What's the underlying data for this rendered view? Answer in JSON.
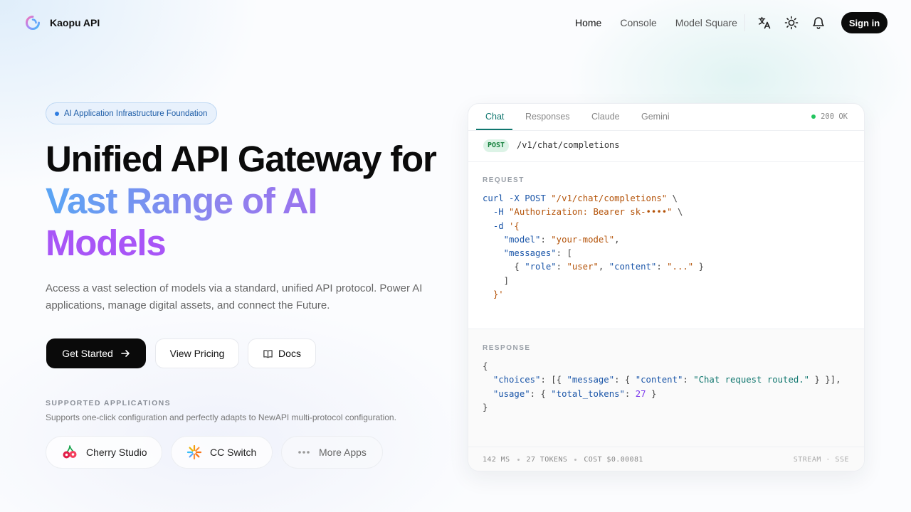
{
  "nav": {
    "brand": "Kaopu API",
    "links": [
      "Home",
      "Console",
      "Model Square"
    ],
    "icons": [
      "translate-icon",
      "sun-icon",
      "bell-icon"
    ],
    "signin": "Sign in"
  },
  "hero": {
    "badge": "AI Application Infrastructure Foundation",
    "title_line1": "Unified API Gateway for",
    "title_line2": "Vast Range of AI",
    "title_line3": "Models",
    "description": "Access a vast selection of models via a standard, unified API protocol. Power AI applications, manage digital assets, and connect the Future.",
    "buttons": {
      "get_started": "Get Started",
      "view_pricing": "View Pricing",
      "docs": "Docs"
    },
    "supported_title": "SUPPORTED APPLICATIONS",
    "supported_desc": "Supports one-click configuration and perfectly adapts to NewAPI multi-protocol configuration.",
    "apps": [
      "Cherry Studio",
      "CC Switch",
      "More Apps"
    ]
  },
  "card": {
    "tabs": [
      "Chat",
      "Responses",
      "Claude",
      "Gemini"
    ],
    "active_tab": "Chat",
    "status": "200 OK",
    "method": "POST",
    "path": "/v1/chat/completions",
    "request_label": "REQUEST",
    "request_lines": [
      "curl -X POST \"/v1/chat/completions\" \\",
      "  -H \"Authorization: Bearer sk-••••\" \\",
      "  -d '{",
      "    \"model\": \"your-model\",",
      "    \"messages\": [",
      "      { \"role\": \"user\", \"content\": \"...\" }",
      "    ]",
      "  }'"
    ],
    "response_label": "RESPONSE",
    "response_lines": [
      "{",
      "  \"choices\": [{ \"message\": { \"content\": \"Chat request routed.\" } }],",
      "  \"usage\": { \"total_tokens\": 27 }",
      "}"
    ],
    "metrics": [
      "142 MS",
      "27 TOKENS",
      "COST $0.00081"
    ],
    "stream": "STREAM · SSE"
  },
  "colors": {
    "accent": "#0f766e",
    "primary_button": "#0a0a0a",
    "gradient": [
      "#5aa5f4",
      "#8f83ee",
      "#a85cf0"
    ],
    "status_dot": "#22c55e"
  }
}
